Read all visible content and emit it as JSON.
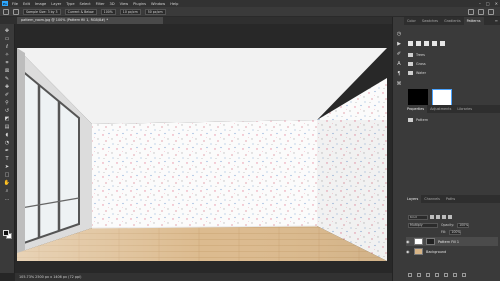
{
  "menubar": {
    "items": [
      "File",
      "Edit",
      "Image",
      "Layer",
      "Type",
      "Select",
      "Filter",
      "3D",
      "View",
      "Plugins",
      "Window",
      "Help"
    ],
    "controls": [
      "–",
      "□",
      "✕"
    ]
  },
  "options": {
    "sample_size": "Sample Size: 3 by 3",
    "field1": "Current & Below",
    "field2": "100%",
    "field3": "10 px/cm",
    "field4": "50 px/cm"
  },
  "document_tab": "pattern_room.jpg @ 100% (Pattern fill 1, RGB/8#) *",
  "status_bar": "105.73%    2500 px x 1406 px (72 ppi)",
  "tools": [
    {
      "name": "move-tool-icon",
      "glyph": "✥"
    },
    {
      "name": "artboard-tool-icon",
      "glyph": "▭"
    },
    {
      "name": "lasso-tool-icon",
      "glyph": "ℓ"
    },
    {
      "name": "magic-wand-icon",
      "glyph": "✧"
    },
    {
      "name": "crop-tool-icon",
      "glyph": "⌗"
    },
    {
      "name": "frame-tool-icon",
      "glyph": "⊠"
    },
    {
      "name": "eyedropper-icon",
      "glyph": "✎"
    },
    {
      "name": "healing-brush-icon",
      "glyph": "✚"
    },
    {
      "name": "brush-tool-icon",
      "glyph": "✐"
    },
    {
      "name": "clone-stamp-icon",
      "glyph": "⚲"
    },
    {
      "name": "history-brush-icon",
      "glyph": "↺"
    },
    {
      "name": "eraser-tool-icon",
      "glyph": "◩"
    },
    {
      "name": "gradient-tool-icon",
      "glyph": "▤"
    },
    {
      "name": "blur-tool-icon",
      "glyph": "◖"
    },
    {
      "name": "dodge-tool-icon",
      "glyph": "◔"
    },
    {
      "name": "pen-tool-icon",
      "glyph": "✒"
    },
    {
      "name": "type-tool-icon",
      "glyph": "T"
    },
    {
      "name": "path-selection-icon",
      "glyph": "➤"
    },
    {
      "name": "rectangle-tool-icon",
      "glyph": "□"
    },
    {
      "name": "hand-tool-icon",
      "glyph": "✋"
    },
    {
      "name": "zoom-tool-icon",
      "glyph": "⌕"
    },
    {
      "name": "more-tools-icon",
      "glyph": "…"
    }
  ],
  "right_panel": {
    "top_tabs": [
      "Color",
      "Swatches",
      "Gradients",
      "Patterns"
    ],
    "pattern_folders": [
      "Trees",
      "Grass",
      "Water"
    ],
    "properties_tabs": [
      "Properties",
      "Adjustments",
      "Libraries"
    ],
    "properties_title": "Pattern",
    "layers_tabs": [
      "Layers",
      "Channels",
      "Paths"
    ],
    "layer_filter": "Kind",
    "blend_mode": "Multiply",
    "opacity_label": "Opacity:",
    "opacity_value": "100%",
    "fill_label": "Fill:",
    "fill_value": "100%",
    "layers": [
      {
        "name": "Pattern Fill 1",
        "selected": true
      },
      {
        "name": "Background",
        "selected": false
      }
    ]
  },
  "colors": {
    "accent": "#2ea8ff",
    "ui_dark": "#262626",
    "panel": "#3a3a3a"
  }
}
